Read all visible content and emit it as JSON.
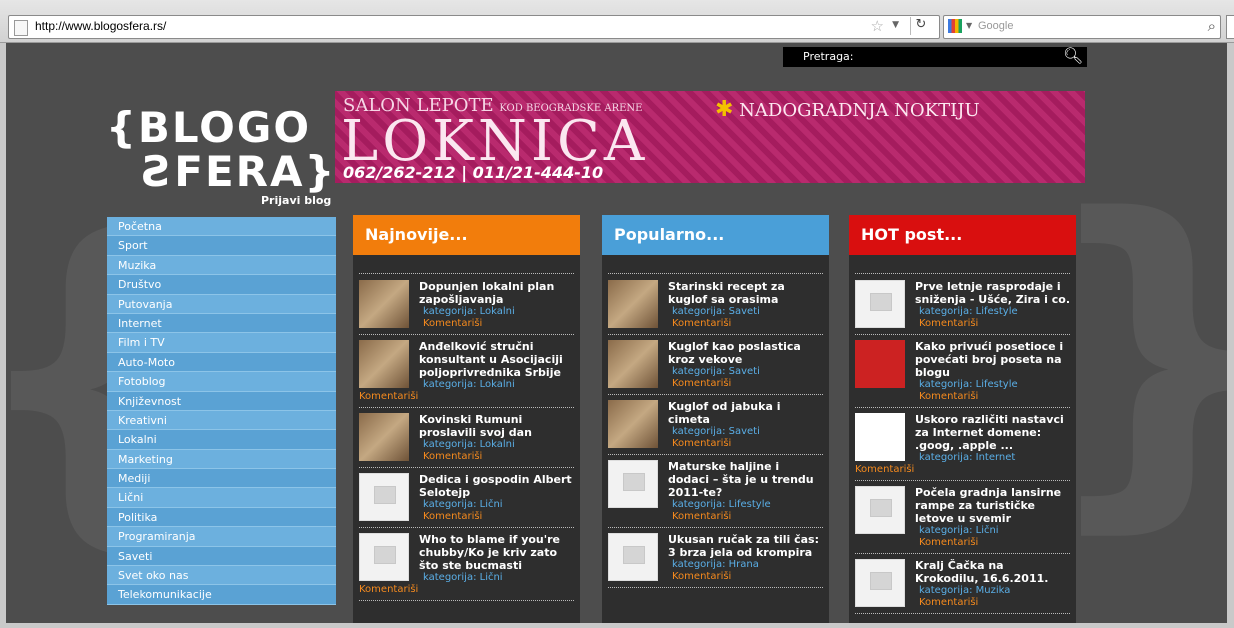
{
  "browser": {
    "url": "http://www.blogosfera.rs/",
    "search_placeholder": "Google"
  },
  "header": {
    "search_label": "Pretraga:",
    "logo_line1": "{BLOGO",
    "logo_line2": "ƧFERA}",
    "login_link": "Prijavi blog"
  },
  "banner": {
    "salon": "SALON LEPOTE",
    "kod": "KOD BEOGRADSKE ARENE",
    "name": "LOKNICA",
    "phone": "062/262-212 | 011/21-444-10",
    "promo": "NADOGRADNJA NOKTIJU"
  },
  "nav": {
    "items": [
      "Početna",
      "Sport",
      "Muzika",
      "Društvo",
      "Putovanja",
      "Internet",
      "Film i TV",
      "Auto-Moto",
      "Fotoblog",
      "Književnost",
      "Kreativni",
      "Lokalni",
      "Marketing",
      "Mediji",
      "Lični",
      "Politika",
      "Programiranja",
      "Saveti",
      "Svet oko nas",
      "Telekomunikacije"
    ]
  },
  "columns": {
    "najnovije": {
      "title": "Najnovije...",
      "color": "#f27d0c",
      "posts": [
        {
          "title": "Dopunjen lokalni plan zapošljavanja",
          "category": "kategorija: Lokalni",
          "comments": "Komentariši"
        },
        {
          "title": "Anđelković stručni konsultant u Asocijaciji poljoprivrednika Srbije",
          "category": "kategorija: Lokalni",
          "comments": "Komentariši"
        },
        {
          "title": "Kovinski Rumuni proslavili svoj dan",
          "category": "kategorija: Lokalni",
          "comments": "Komentariši"
        },
        {
          "title": "Dedica i gospodin Albert Selotejp",
          "category": "kategorija: Lični",
          "comments": "Komentariši"
        },
        {
          "title": "Who to blame if you're chubby/Ko je kriv zato što ste bucmasti",
          "category": "kategorija: Lični",
          "comments": "Komentariši"
        }
      ]
    },
    "popularno": {
      "title": "Popularno...",
      "color": "#4a9fd8",
      "posts": [
        {
          "title": "Starinski recept za kuglof sa orasima",
          "category": "kategorija: Saveti",
          "comments": "Komentariši"
        },
        {
          "title": "Kuglof kao poslastica kroz vekove",
          "category": "kategorija: Saveti",
          "comments": "Komentariši"
        },
        {
          "title": "Kuglof od jabuka i cimeta",
          "category": "kategorija: Saveti",
          "comments": "Komentariši"
        },
        {
          "title": "Maturske haljine i dodaci – šta je u trendu 2011-te?",
          "category": "kategorija: Lifestyle",
          "comments": "Komentariši"
        },
        {
          "title": "Ukusan ručak za tili čas: 3 brza jela od krompira",
          "category": "kategorija: Hrana",
          "comments": "Komentariši"
        }
      ]
    },
    "hot": {
      "title": "HOT post...",
      "color": "#d90f0f",
      "posts": [
        {
          "title": "Prve letnje rasprodaje i sniženja - Ušće, Zira i co.",
          "category": "kategorija: Lifestyle",
          "comments": "Komentariši"
        },
        {
          "title": "Kako privući posetioce i povećati broj poseta na blogu",
          "category": "kategorija: Lifestyle",
          "comments": "Komentariši"
        },
        {
          "title": "Uskoro različiti nastavci za Internet domene: .goog, .apple ...",
          "category": "kategorija: Internet",
          "comments": "Komentariši"
        },
        {
          "title": "Počela gradnja lansirne rampe za turističke letove u svemir",
          "category": "kategorija: Lični",
          "comments": "Komentariši"
        },
        {
          "title": "Kralj Čačka na Krokodilu, 16.6.2011.",
          "category": "kategorija: Muzika",
          "comments": "Komentariši"
        }
      ]
    }
  }
}
